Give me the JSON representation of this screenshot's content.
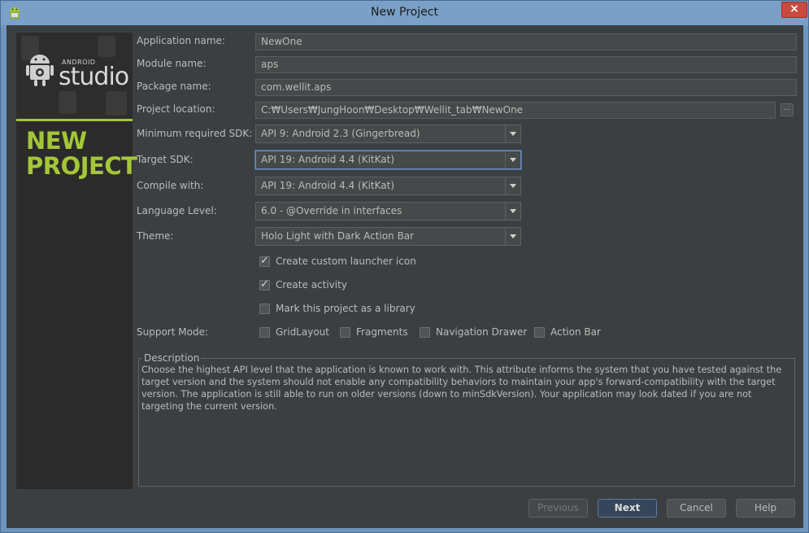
{
  "window": {
    "title": "New Project",
    "close_label": "×",
    "app_icon": "android-robot-icon"
  },
  "banner": {
    "android_label": "ANDROID",
    "studio_label": "studio",
    "title_line1": "NEW",
    "title_line2": "PROJECT",
    "accent_color": "#a4c639"
  },
  "form": {
    "app_name_label": "Application name:",
    "app_name_value": "NewOne",
    "module_name_label": "Module name:",
    "module_name_value": "aps",
    "package_name_label": "Package name:",
    "package_name_value": "com.wellit.aps",
    "project_location_label": "Project location:",
    "project_location_value": "C:₩Users₩JungHoon₩Desktop₩Wellit_tab₩NewOne",
    "browse_label": "...",
    "min_sdk_label": "Minimum required SDK:",
    "min_sdk_value": "API 9: Android 2.3 (Gingerbread)",
    "target_sdk_label": "Target SDK:",
    "target_sdk_value": "API 19: Android 4.4 (KitKat)",
    "compile_with_label": "Compile with:",
    "compile_with_value": "API 19: Android 4.4 (KitKat)",
    "language_level_label": "Language Level:",
    "language_level_value": "6.0 - @Override in interfaces",
    "theme_label": "Theme:",
    "theme_value": "Holo Light with Dark Action Bar"
  },
  "options": {
    "launcher_icon": {
      "label": "Create custom launcher icon",
      "checked": true
    },
    "create_activity": {
      "label": "Create activity",
      "checked": true
    },
    "library": {
      "label": "Mark this project as a library",
      "checked": false
    }
  },
  "support_mode": {
    "label": "Support Mode:",
    "items": [
      {
        "label": "GridLayout",
        "checked": false
      },
      {
        "label": "Fragments",
        "checked": false
      },
      {
        "label": "Navigation Drawer",
        "checked": false
      },
      {
        "label": "Action Bar",
        "checked": false
      }
    ]
  },
  "description": {
    "title": "Description",
    "text": "Choose the highest API level that the application is known to work with. This attribute informs the system that you have tested against the target version and the system should not enable any compatibility behaviors to maintain your app's forward-compatibility with the target version. The application is still able to run on older versions (down to minSdkVersion). Your application may look dated if you are not targeting the current version."
  },
  "buttons": {
    "previous": "Previous",
    "next": "Next",
    "cancel": "Cancel",
    "help": "Help"
  }
}
